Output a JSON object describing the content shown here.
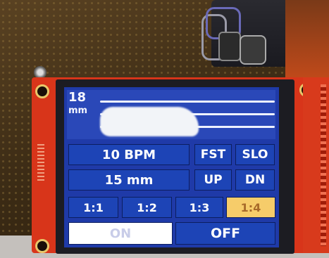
{
  "display": {
    "value": "18",
    "unit": "mm"
  },
  "controls": {
    "rate_label": "10 BPM",
    "volume_label": "15 mm",
    "fast_label": "FST",
    "slow_label": "SLO",
    "up_label": "UP",
    "down_label": "DN",
    "ratios": [
      "1:1",
      "1:2",
      "1:3",
      "1:4"
    ],
    "selected_ratio": "1:4",
    "on_label": "ON",
    "off_label": "OFF"
  },
  "colors": {
    "screen_bg": "#1f3aa8",
    "button": "#1d44b6",
    "highlight": "#f6cc6a",
    "board": "#d8351a"
  }
}
